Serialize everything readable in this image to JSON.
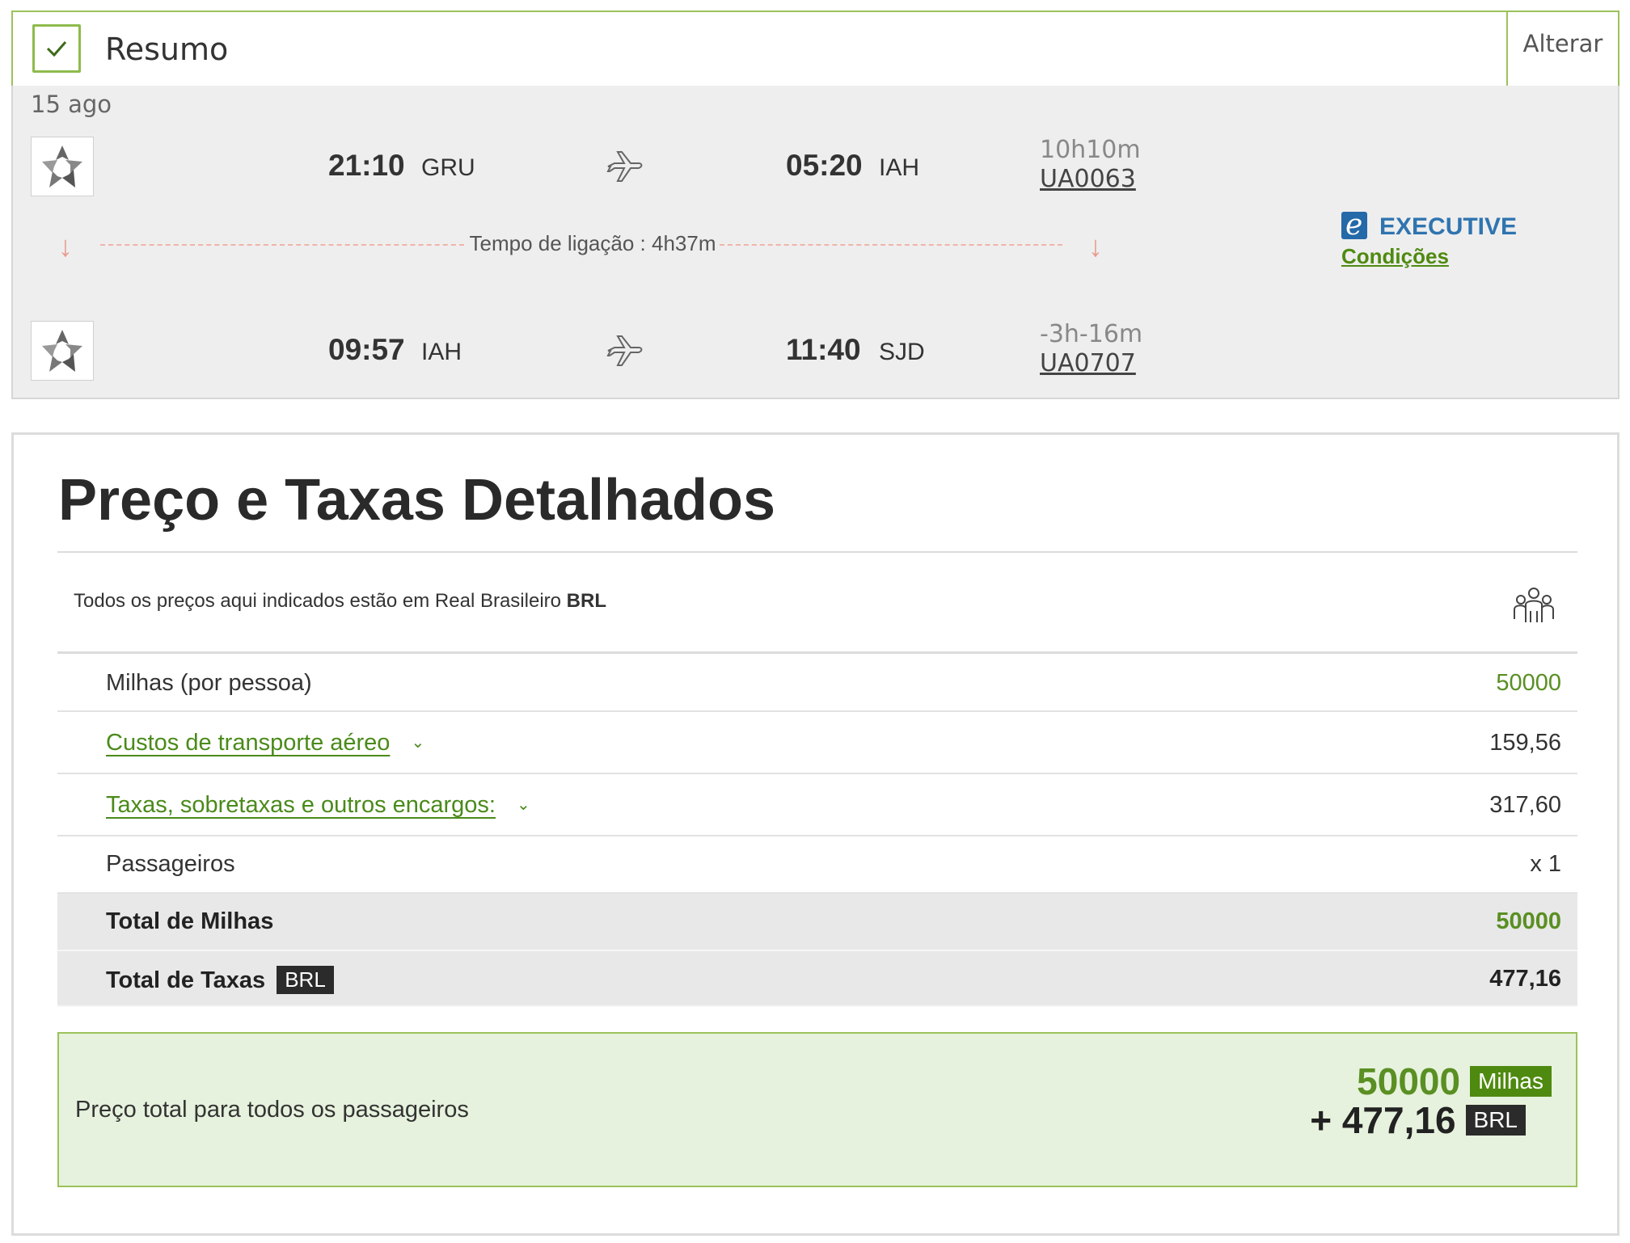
{
  "summary": {
    "title": "Resumo",
    "change_label": "Alterar"
  },
  "itinerary": {
    "date": "15 ago",
    "segments": [
      {
        "dep_time": "21:10",
        "dep_code": "GRU",
        "arr_time": "05:20",
        "arr_code": "IAH",
        "duration": "10h10m",
        "flight_no": "UA0063",
        "airline_logo": "star-alliance-logo"
      },
      {
        "dep_time": "09:57",
        "dep_code": "IAH",
        "arr_time": "11:40",
        "arr_code": "SJD",
        "duration": "-3h-16m",
        "flight_no": "UA0707",
        "airline_logo": "star-alliance-logo"
      }
    ],
    "connection": "Tempo de ligação : 4h37m",
    "cabin": {
      "icon_letter": "e",
      "label": "EXECUTIVE",
      "conditions_link": "Condições"
    }
  },
  "price": {
    "title": "Preço e Taxas Detalhados",
    "currency_note_prefix": "Todos os preços aqui indicados estão em Real Brasileiro",
    "currency_code": "BRL",
    "rows": [
      {
        "label": "Milhas (por pessoa)",
        "value": "50000"
      },
      {
        "label": "Custos de transporte aéreo",
        "value": "159,56"
      },
      {
        "label": "Taxas, sobretaxas e outros encargos:",
        "value": "317,60"
      },
      {
        "label": "Passageiros",
        "value": "x 1"
      }
    ],
    "totals": [
      {
        "label": "Total de Milhas",
        "value": "50000"
      },
      {
        "label": "Total de Taxas",
        "tag": "BRL",
        "value": "477,16"
      }
    ],
    "grand_total": {
      "label": "Preço total para todos os passageiros",
      "miles": "50000",
      "miles_tag": "Milhas",
      "brl": "+ 477,16",
      "brl_tag": "BRL"
    }
  },
  "colors": {
    "accent_green": "#4f8a10",
    "border_green": "#9bc25a",
    "cabin_blue": "#2f74b0",
    "connection_red": "#e9998c"
  }
}
